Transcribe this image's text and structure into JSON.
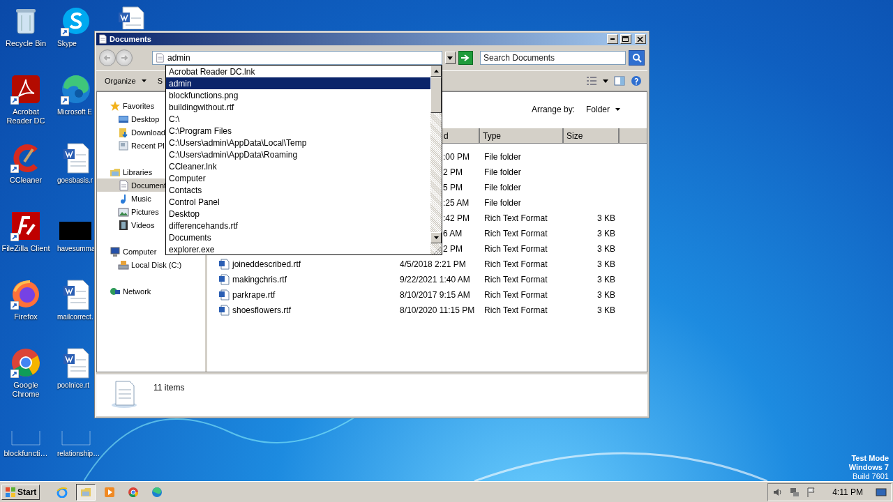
{
  "desktop": {
    "icons": [
      {
        "label": "Recycle Bin",
        "kind": "recycle",
        "shortcut": false
      },
      {
        "label": "Acrobat Reader DC",
        "kind": "acrobat",
        "shortcut": true
      },
      {
        "label": "CCleaner",
        "kind": "ccleaner",
        "shortcut": true
      },
      {
        "label": "FileZilla Client",
        "kind": "filezilla",
        "shortcut": true
      },
      {
        "label": "Firefox",
        "kind": "firefox",
        "shortcut": true
      },
      {
        "label": "Google Chrome",
        "kind": "chrome",
        "shortcut": true
      },
      {
        "label": "blockfuncti…",
        "kind": "blank",
        "shortcut": false
      },
      {
        "label": "Skype",
        "kind": "skype",
        "shortcut": true
      },
      {
        "label": "Microsoft E",
        "kind": "edge",
        "shortcut": true
      },
      {
        "label": "goesbasis.r",
        "kind": "word",
        "shortcut": false
      },
      {
        "label": "havesumma",
        "kind": "dark",
        "shortcut": false
      },
      {
        "label": "mailcorrect.",
        "kind": "word",
        "shortcut": false
      },
      {
        "label": "poolnice.rt",
        "kind": "word",
        "shortcut": false
      },
      {
        "label": "relationship…",
        "kind": "blank",
        "shortcut": false
      },
      {
        "kind": "word",
        "shortcut": false
      }
    ],
    "os_notice": [
      "Test Mode",
      "Windows 7",
      "Build 7601"
    ]
  },
  "window": {
    "title": "Documents",
    "address": {
      "value": "admin"
    },
    "search": {
      "placeholder": "Search Documents"
    },
    "autocomplete": [
      {
        "label": "Acrobat Reader DC.lnk",
        "selected": false
      },
      {
        "label": "admin",
        "selected": true
      },
      {
        "label": "blockfunctions.png",
        "selected": false
      },
      {
        "label": "buildingwithout.rtf",
        "selected": false
      },
      {
        "label": "C:\\",
        "selected": false
      },
      {
        "label": "C:\\Program Files",
        "selected": false
      },
      {
        "label": "C:\\Users\\admin\\AppData\\Local\\Temp",
        "selected": false
      },
      {
        "label": "C:\\Users\\admin\\AppData\\Roaming",
        "selected": false
      },
      {
        "label": "CCleaner.lnk",
        "selected": false
      },
      {
        "label": "Computer",
        "selected": false
      },
      {
        "label": "Contacts",
        "selected": false
      },
      {
        "label": "Control Panel",
        "selected": false
      },
      {
        "label": "Desktop",
        "selected": false
      },
      {
        "label": "differencehands.rtf",
        "selected": false
      },
      {
        "label": "Documents",
        "selected": false
      },
      {
        "label": "explorer.exe",
        "selected": false
      }
    ],
    "toolbar": [
      "Organize",
      "S"
    ],
    "nav": [
      {
        "label": "Favorites",
        "kind": "star",
        "children": [
          {
            "label": "Desktop",
            "kind": "desktop",
            "selected": false
          },
          {
            "label": "Download",
            "kind": "downloads",
            "selected": false
          },
          {
            "label": "Recent Pl",
            "kind": "recent",
            "selected": false
          }
        ]
      },
      {
        "label": "Libraries",
        "kind": "library",
        "children": [
          {
            "label": "Document",
            "kind": "document",
            "selected": true
          },
          {
            "label": "Music",
            "kind": "music",
            "selected": false
          },
          {
            "label": "Pictures",
            "kind": "pictures",
            "selected": false
          },
          {
            "label": "Videos",
            "kind": "videos",
            "selected": false
          }
        ]
      },
      {
        "label": "Computer",
        "kind": "computer",
        "children": [
          {
            "label": "Local Disk (C:)",
            "kind": "disk",
            "selected": false
          }
        ]
      },
      {
        "label": "Network",
        "kind": "network"
      }
    ],
    "arrange": {
      "label": "Arrange by:",
      "value": "Folder"
    },
    "columns": [
      "d",
      "Type",
      "Size"
    ],
    "rows": [
      {
        "date": ":00 PM",
        "type": "File folder"
      },
      {
        "date": "2 PM",
        "type": "File folder"
      },
      {
        "date": "5 PM",
        "type": "File folder"
      },
      {
        "date": ":25 AM",
        "type": "File folder"
      },
      {
        "date": ":42 PM",
        "type": "Rich Text Format",
        "size": "3 KB"
      },
      {
        "date": "6 AM",
        "type": "Rich Text Format",
        "size": "3 KB"
      },
      {
        "date": "2 PM",
        "type": "Rich Text Format",
        "size": "3 KB"
      },
      {
        "name": "joineddescribed.rtf",
        "kind": "rtf",
        "date": "4/5/2018 2:21 PM",
        "type": "Rich Text Format",
        "size": "3 KB"
      },
      {
        "name": "makingchris.rtf",
        "kind": "rtf",
        "date": "9/22/2021 1:40 AM",
        "type": "Rich Text Format",
        "size": "3 KB"
      },
      {
        "name": "parkrape.rtf",
        "kind": "rtf",
        "date": "8/10/2017 9:15 AM",
        "type": "Rich Text Format",
        "size": "3 KB"
      },
      {
        "name": "shoesflowers.rtf",
        "kind": "rtf",
        "date": "8/10/2020 11:15 PM",
        "type": "Rich Text Format",
        "size": "3 KB"
      }
    ],
    "status": "11 items"
  },
  "taskbar": {
    "start": "Start",
    "apps": [
      {
        "kind": "ie",
        "selected": false
      },
      {
        "kind": "explorer",
        "selected": true
      },
      {
        "kind": "media",
        "selected": false
      },
      {
        "kind": "chrome",
        "selected": false
      },
      {
        "kind": "edge",
        "selected": false
      }
    ],
    "clock": "4:11 PM"
  }
}
